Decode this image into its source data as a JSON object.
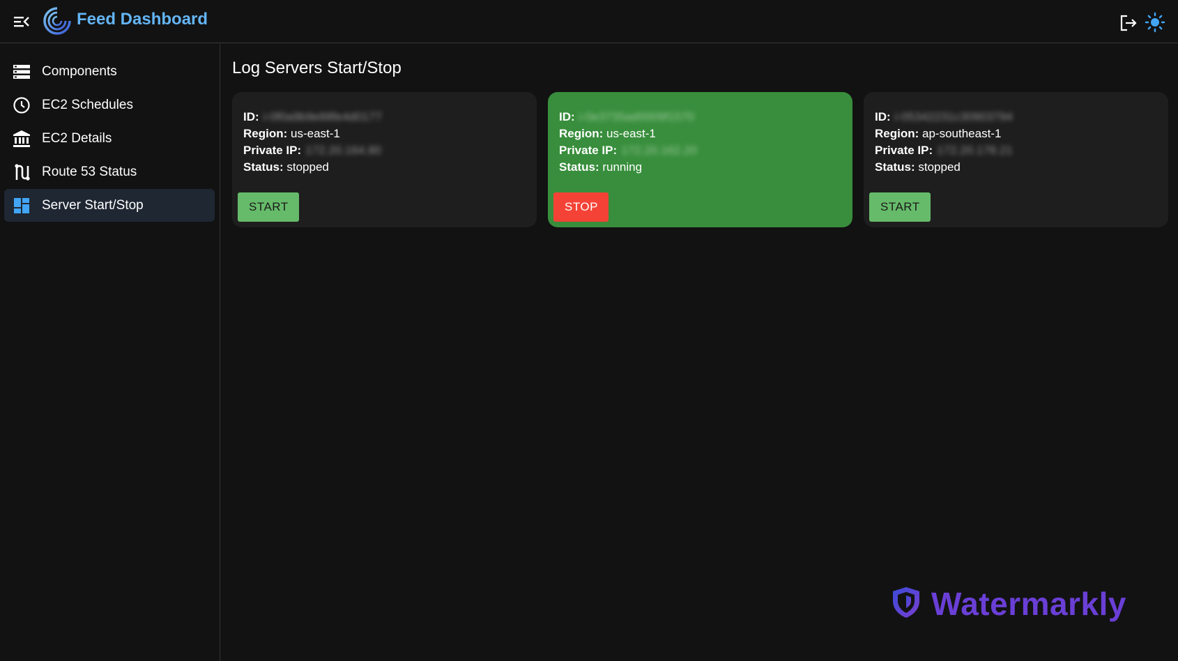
{
  "header": {
    "app_title": "Feed Dashboard",
    "menu_icon": "menu-collapse-icon",
    "logo_icon": "swirl-logo",
    "logout_icon": "logout-icon",
    "theme_icon": "sun-icon",
    "accent_color": "#64b5f6"
  },
  "sidebar": {
    "items": [
      {
        "label": "Components",
        "icon": "list-icon",
        "active": false
      },
      {
        "label": "EC2 Schedules",
        "icon": "clock-icon",
        "active": false
      },
      {
        "label": "EC2 Details",
        "icon": "bank-icon",
        "active": false
      },
      {
        "label": "Route 53 Status",
        "icon": "route-icon",
        "active": false
      },
      {
        "label": "Server Start/Stop",
        "icon": "dashboard-icon",
        "active": true
      }
    ]
  },
  "main": {
    "title": "Log Servers Start/Stop",
    "labels": {
      "id": "ID:",
      "region": "Region:",
      "private_ip": "Private IP:",
      "status": "Status:"
    },
    "servers": [
      {
        "id": "i-0f0a9b9e88fe4d0177",
        "region": "us-east-1",
        "private_ip": "172.20.164.80",
        "status": "stopped",
        "action": "START"
      },
      {
        "id": "i-0e3735ad0009f1570",
        "region": "us-east-1",
        "private_ip": "172.20.162.20",
        "status": "running",
        "action": "STOP"
      },
      {
        "id": "i-05342231c30903794",
        "region": "ap-southeast-1",
        "private_ip": "172.20.178.21",
        "status": "stopped",
        "action": "START"
      }
    ],
    "colors": {
      "running_card": "#388e3c",
      "start_button": "#66bb6a",
      "stop_button": "#f44336"
    }
  },
  "watermark": {
    "text": "Watermarkly",
    "icon": "shield-icon",
    "color": "#6a3fd6"
  }
}
